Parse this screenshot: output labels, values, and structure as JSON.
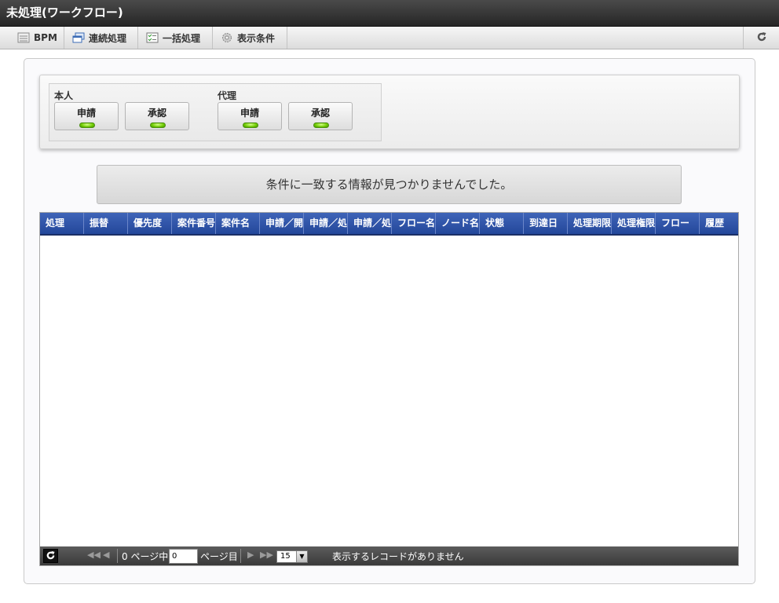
{
  "window": {
    "title": "未処理(ワークフロー)"
  },
  "toolbar": {
    "items": [
      {
        "label": "BPM",
        "icon": "calendar-list-icon"
      },
      {
        "label": "連続処理",
        "icon": "windows-icon"
      },
      {
        "label": "一括処理",
        "icon": "checklist-icon"
      },
      {
        "label": "表示条件",
        "icon": "gear-icon"
      }
    ],
    "refresh_icon": "refresh-icon"
  },
  "filter": {
    "self": {
      "label": "本人",
      "apply": "申請",
      "approve": "承認"
    },
    "proxy": {
      "label": "代理",
      "apply": "申請",
      "approve": "承認"
    }
  },
  "message": "条件に一致する情報が見つかりませんでした。",
  "grid": {
    "columns": [
      "処理",
      "振替",
      "優先度",
      "案件番号",
      "案件名",
      "申請／開始",
      "申請／処",
      "申請／処",
      "フロー名",
      "ノード名",
      "状態",
      "到達日",
      "処理期限",
      "処理権限",
      "フロー",
      "履歴"
    ],
    "rows": []
  },
  "pager": {
    "page_count_text": "0 ページ中",
    "page_value": "0",
    "page_suffix": "ページ目",
    "page_size": "15",
    "status": "表示するレコードがありません"
  },
  "colors": {
    "header_blue": "#2e52a8",
    "led_green": "#6dc900"
  }
}
